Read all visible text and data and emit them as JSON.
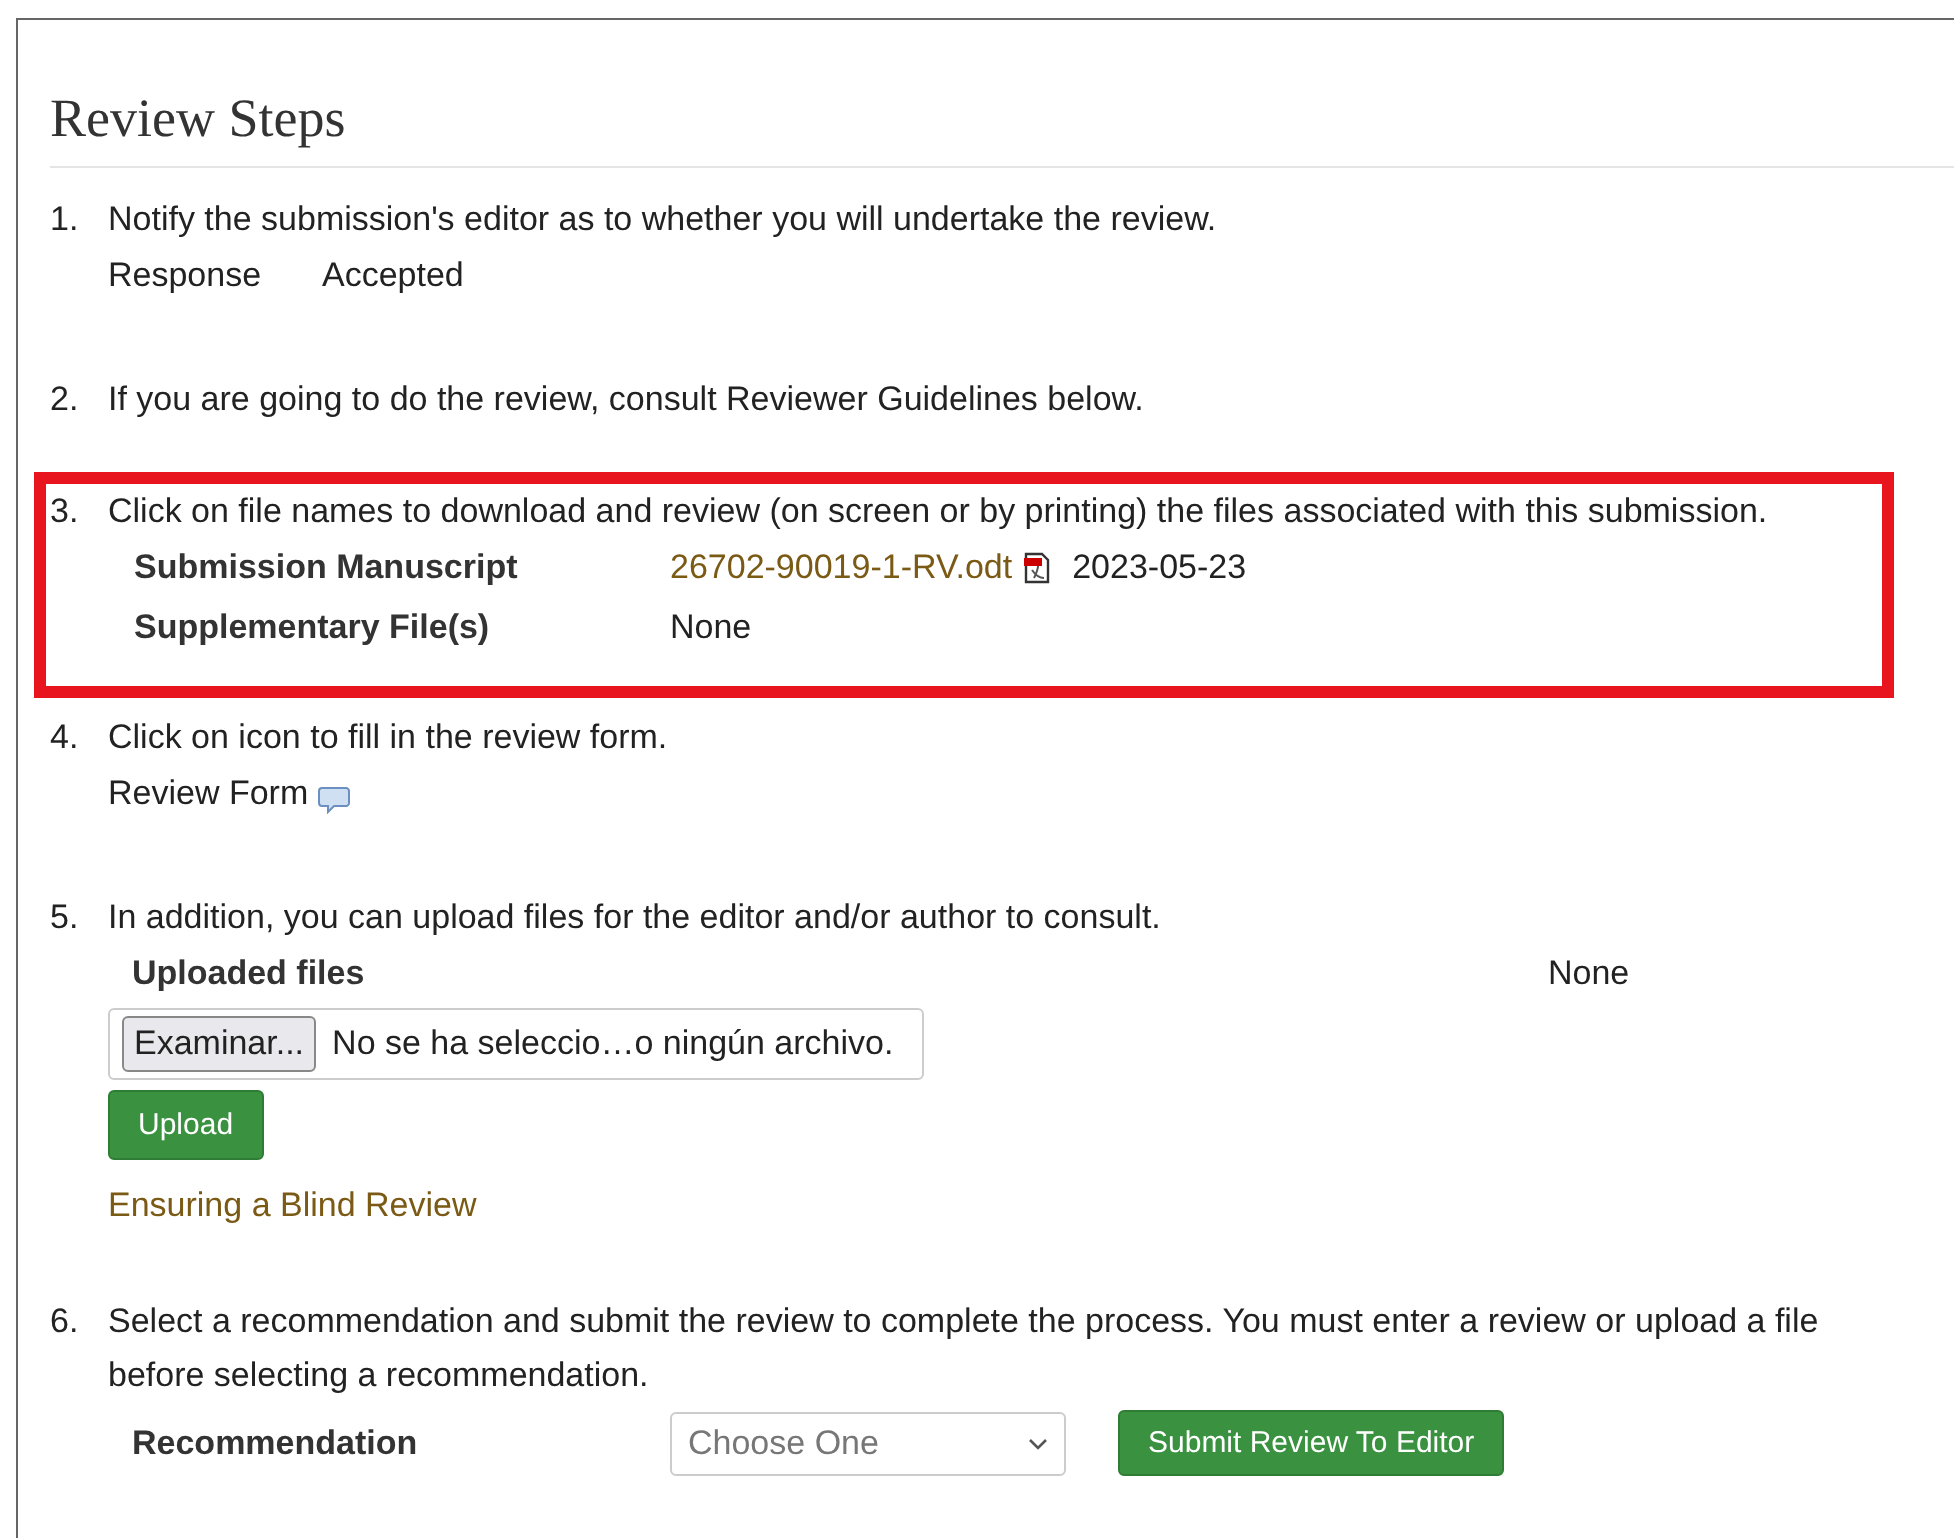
{
  "heading": "Review Steps",
  "steps": [
    {
      "number": "1.",
      "text": "Notify the submission's editor as to whether you will undertake the review.",
      "highlighted": false,
      "kind": "response",
      "label": "Response",
      "value": "Accepted"
    },
    {
      "number": "2.",
      "text": "If you are going to do the review, consult Reviewer Guidelines below.",
      "highlighted": false,
      "kind": "plain"
    },
    {
      "number": "3.",
      "text": "Click on file names to download and review (on screen or by printing) the files associated with this submission.",
      "highlighted": true,
      "kind": "files",
      "files": [
        {
          "label": "Submission Manuscript",
          "link": "26702-90019-1-RV.odt",
          "date": "2023-05-23"
        },
        {
          "label": "Supplementary File(s)",
          "value": "None"
        }
      ]
    },
    {
      "number": "4.",
      "text": "Click on icon to fill in the review form.",
      "highlighted": false,
      "kind": "form",
      "label": "Review Form"
    },
    {
      "number": "5.",
      "text": "In addition, you can upload files for the editor and/or author to consult.",
      "highlighted": false,
      "kind": "upload",
      "label": "Uploaded files",
      "value": "None",
      "browse": "Examinar...",
      "file_status": "No se ha seleccio…o ningún archivo.",
      "button": "Upload",
      "link": "Ensuring a Blind Review"
    },
    {
      "number": "6.",
      "text": "Select a recommendation and submit the review to complete the process. You must enter a review or upload a file before selecting a recommendation.",
      "highlighted": false,
      "kind": "recommend",
      "label": "Recommendation",
      "placeholder": "Choose One",
      "button": "Submit Review To Editor"
    }
  ]
}
